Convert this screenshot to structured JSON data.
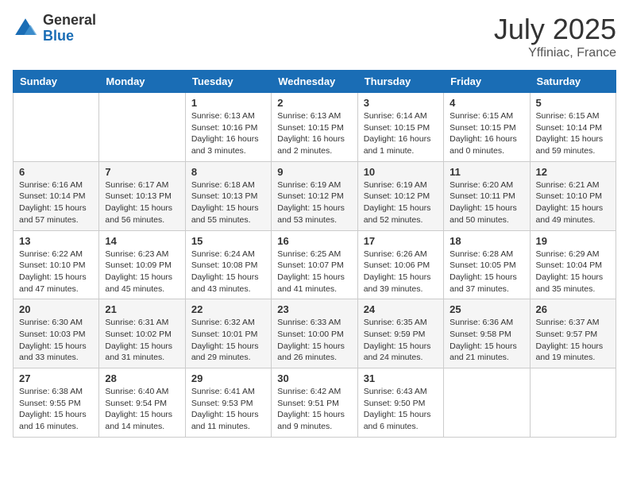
{
  "logo": {
    "general": "General",
    "blue": "Blue"
  },
  "header": {
    "month": "July 2025",
    "location": "Yffiniac, France"
  },
  "days_of_week": [
    "Sunday",
    "Monday",
    "Tuesday",
    "Wednesday",
    "Thursday",
    "Friday",
    "Saturday"
  ],
  "weeks": [
    [
      {
        "day": "",
        "info": ""
      },
      {
        "day": "",
        "info": ""
      },
      {
        "day": "1",
        "info": "Sunrise: 6:13 AM\nSunset: 10:16 PM\nDaylight: 16 hours\nand 3 minutes."
      },
      {
        "day": "2",
        "info": "Sunrise: 6:13 AM\nSunset: 10:15 PM\nDaylight: 16 hours\nand 2 minutes."
      },
      {
        "day": "3",
        "info": "Sunrise: 6:14 AM\nSunset: 10:15 PM\nDaylight: 16 hours\nand 1 minute."
      },
      {
        "day": "4",
        "info": "Sunrise: 6:15 AM\nSunset: 10:15 PM\nDaylight: 16 hours\nand 0 minutes."
      },
      {
        "day": "5",
        "info": "Sunrise: 6:15 AM\nSunset: 10:14 PM\nDaylight: 15 hours\nand 59 minutes."
      }
    ],
    [
      {
        "day": "6",
        "info": "Sunrise: 6:16 AM\nSunset: 10:14 PM\nDaylight: 15 hours\nand 57 minutes."
      },
      {
        "day": "7",
        "info": "Sunrise: 6:17 AM\nSunset: 10:13 PM\nDaylight: 15 hours\nand 56 minutes."
      },
      {
        "day": "8",
        "info": "Sunrise: 6:18 AM\nSunset: 10:13 PM\nDaylight: 15 hours\nand 55 minutes."
      },
      {
        "day": "9",
        "info": "Sunrise: 6:19 AM\nSunset: 10:12 PM\nDaylight: 15 hours\nand 53 minutes."
      },
      {
        "day": "10",
        "info": "Sunrise: 6:19 AM\nSunset: 10:12 PM\nDaylight: 15 hours\nand 52 minutes."
      },
      {
        "day": "11",
        "info": "Sunrise: 6:20 AM\nSunset: 10:11 PM\nDaylight: 15 hours\nand 50 minutes."
      },
      {
        "day": "12",
        "info": "Sunrise: 6:21 AM\nSunset: 10:10 PM\nDaylight: 15 hours\nand 49 minutes."
      }
    ],
    [
      {
        "day": "13",
        "info": "Sunrise: 6:22 AM\nSunset: 10:10 PM\nDaylight: 15 hours\nand 47 minutes."
      },
      {
        "day": "14",
        "info": "Sunrise: 6:23 AM\nSunset: 10:09 PM\nDaylight: 15 hours\nand 45 minutes."
      },
      {
        "day": "15",
        "info": "Sunrise: 6:24 AM\nSunset: 10:08 PM\nDaylight: 15 hours\nand 43 minutes."
      },
      {
        "day": "16",
        "info": "Sunrise: 6:25 AM\nSunset: 10:07 PM\nDaylight: 15 hours\nand 41 minutes."
      },
      {
        "day": "17",
        "info": "Sunrise: 6:26 AM\nSunset: 10:06 PM\nDaylight: 15 hours\nand 39 minutes."
      },
      {
        "day": "18",
        "info": "Sunrise: 6:28 AM\nSunset: 10:05 PM\nDaylight: 15 hours\nand 37 minutes."
      },
      {
        "day": "19",
        "info": "Sunrise: 6:29 AM\nSunset: 10:04 PM\nDaylight: 15 hours\nand 35 minutes."
      }
    ],
    [
      {
        "day": "20",
        "info": "Sunrise: 6:30 AM\nSunset: 10:03 PM\nDaylight: 15 hours\nand 33 minutes."
      },
      {
        "day": "21",
        "info": "Sunrise: 6:31 AM\nSunset: 10:02 PM\nDaylight: 15 hours\nand 31 minutes."
      },
      {
        "day": "22",
        "info": "Sunrise: 6:32 AM\nSunset: 10:01 PM\nDaylight: 15 hours\nand 29 minutes."
      },
      {
        "day": "23",
        "info": "Sunrise: 6:33 AM\nSunset: 10:00 PM\nDaylight: 15 hours\nand 26 minutes."
      },
      {
        "day": "24",
        "info": "Sunrise: 6:35 AM\nSunset: 9:59 PM\nDaylight: 15 hours\nand 24 minutes."
      },
      {
        "day": "25",
        "info": "Sunrise: 6:36 AM\nSunset: 9:58 PM\nDaylight: 15 hours\nand 21 minutes."
      },
      {
        "day": "26",
        "info": "Sunrise: 6:37 AM\nSunset: 9:57 PM\nDaylight: 15 hours\nand 19 minutes."
      }
    ],
    [
      {
        "day": "27",
        "info": "Sunrise: 6:38 AM\nSunset: 9:55 PM\nDaylight: 15 hours\nand 16 minutes."
      },
      {
        "day": "28",
        "info": "Sunrise: 6:40 AM\nSunset: 9:54 PM\nDaylight: 15 hours\nand 14 minutes."
      },
      {
        "day": "29",
        "info": "Sunrise: 6:41 AM\nSunset: 9:53 PM\nDaylight: 15 hours\nand 11 minutes."
      },
      {
        "day": "30",
        "info": "Sunrise: 6:42 AM\nSunset: 9:51 PM\nDaylight: 15 hours\nand 9 minutes."
      },
      {
        "day": "31",
        "info": "Sunrise: 6:43 AM\nSunset: 9:50 PM\nDaylight: 15 hours\nand 6 minutes."
      },
      {
        "day": "",
        "info": ""
      },
      {
        "day": "",
        "info": ""
      }
    ]
  ]
}
